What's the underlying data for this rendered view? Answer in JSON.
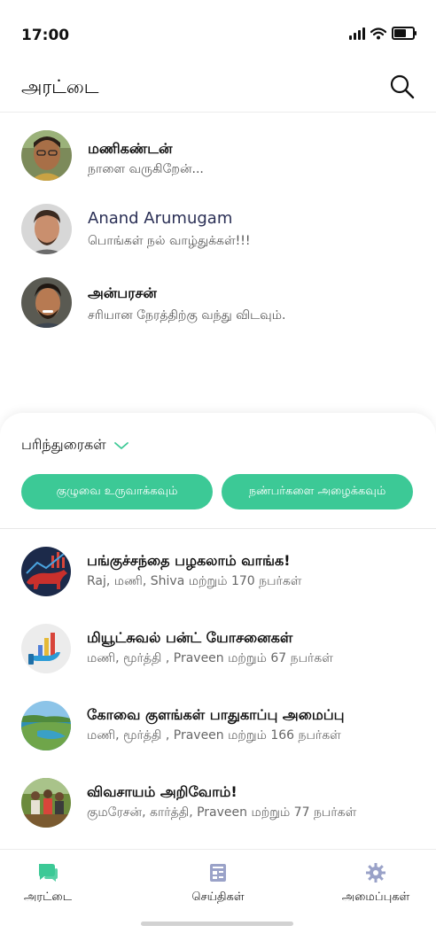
{
  "status": {
    "time": "17:00",
    "battery_level": 0.8
  },
  "header": {
    "title": "அரட்டை",
    "search_icon": "search-icon"
  },
  "chats": [
    {
      "name": "மணிகண்டன்",
      "message": "நாளை வருகிறேன்..."
    },
    {
      "name": "Anand Arumugam",
      "message": "பொங்கள் நல் வாழ்துக்கள்!!!"
    },
    {
      "name": "அன்பரசன்",
      "message": "சரியான நேரத்திற்கு வந்து விடவும்."
    }
  ],
  "recommendations": {
    "title": "பரிந்துரைகள்",
    "create_group_label": "குழுவை உருவாக்கவும்",
    "invite_friends_label": "நண்பர்களை அழைக்கவும்"
  },
  "groups": [
    {
      "name": "பங்குச்சந்தை பழகலாம் வாங்க!",
      "members": "Raj, மணி, Shiva மற்றும் 170 நபர்கள்",
      "icon": "stock-bull-icon"
    },
    {
      "name": "மியூட்சுவல் பன்ட் யோசனைகள்",
      "members": "மணி, மூர்த்தி , Praveen மற்றும் 67 நபர்கள்",
      "icon": "bar-chart-hand-icon"
    },
    {
      "name": "கோவை குளங்கள் பாதுகாப்பு அமைப்பு",
      "members": "மணி, மூர்த்தி , Praveen மற்றும் 166 நபர்கள்",
      "icon": "lake-icon"
    },
    {
      "name": "விவசாயம் அறிவோம்!",
      "members": "குமரேசன், கார்த்தி, Praveen மற்றும் 77 நபர்கள்",
      "icon": "farmers-icon"
    }
  ],
  "tabs": [
    {
      "label": "அரட்டை",
      "icon": "chat-bubble-icon",
      "active": true
    },
    {
      "label": "செய்திகள்",
      "icon": "news-icon",
      "active": false
    },
    {
      "label": "அமைப்புகள்",
      "icon": "gear-icon",
      "active": false
    }
  ],
  "colors": {
    "accent": "#3cc996",
    "active_tab": "#3cc996",
    "inactive_tab": "#9aa2c8"
  }
}
